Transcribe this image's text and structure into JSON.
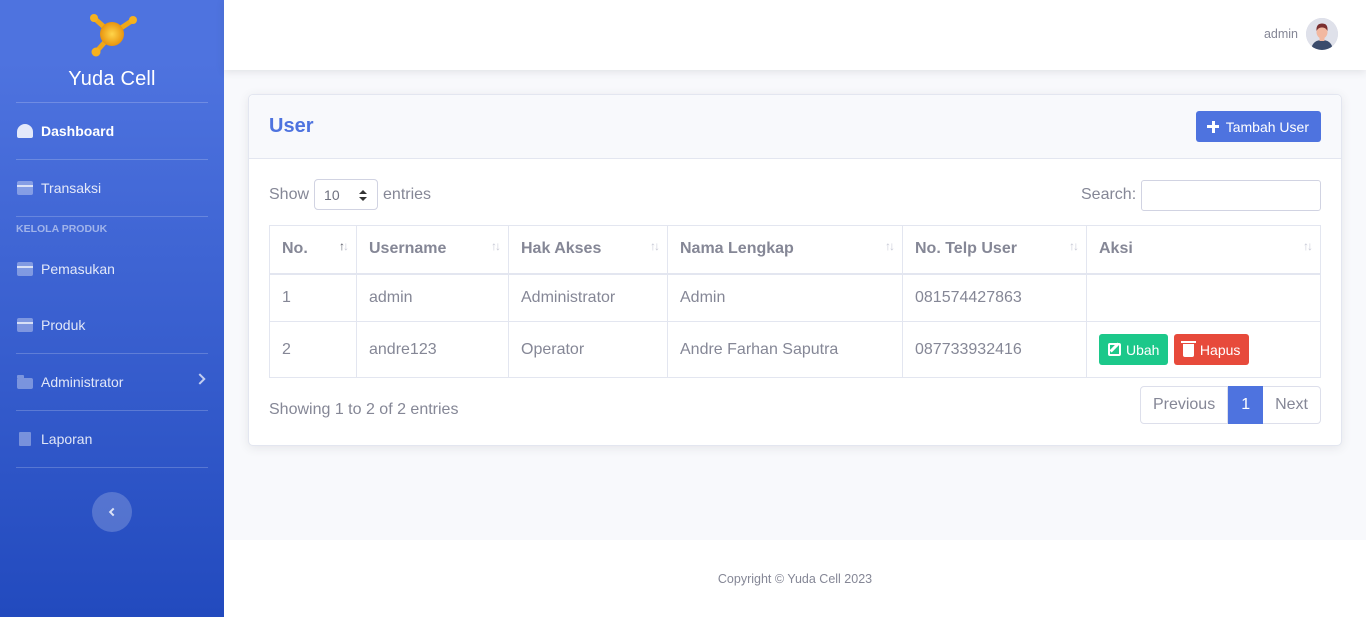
{
  "app": {
    "brand": "Yuda Cell"
  },
  "sidebar": {
    "items": [
      {
        "label": "Dashboard",
        "icon": "gauge-icon"
      },
      {
        "label": "Transaksi",
        "icon": "box-icon"
      },
      {
        "label": "Pemasukan",
        "icon": "box-icon"
      },
      {
        "label": "Produk",
        "icon": "box-icon"
      },
      {
        "label": "Administrator",
        "icon": "folder-icon"
      },
      {
        "label": "Laporan",
        "icon": "file-icon"
      }
    ],
    "heading": "KELOLA PRODUK"
  },
  "topbar": {
    "user": "admin"
  },
  "card": {
    "title": "User",
    "add_button": "Tambah User",
    "show_label": "Show",
    "entries_label": "entries",
    "page_length": "10",
    "search_label": "Search:",
    "search_value": ""
  },
  "table": {
    "columns": [
      "No.",
      "Username",
      "Hak Akses",
      "Nama Lengkap",
      "No. Telp User",
      "Aksi"
    ],
    "rows": [
      {
        "no": "1",
        "username": "admin",
        "hak_akses": "Administrator",
        "nama": "Admin",
        "telp": "081574427863"
      },
      {
        "no": "2",
        "username": "andre123",
        "hak_akses": "Operator",
        "nama": "Andre Farhan Saputra",
        "telp": "087733932416"
      }
    ],
    "edit_label": "Ubah",
    "delete_label": "Hapus"
  },
  "pagination": {
    "info": "Showing 1 to 2 of 2 entries",
    "previous": "Previous",
    "current": "1",
    "next": "Next"
  },
  "footer": {
    "copyright": "Copyright © Yuda Cell 2023"
  },
  "colors": {
    "primary": "#4e73df",
    "success": "#1cc88a",
    "danger": "#e74a3b"
  }
}
